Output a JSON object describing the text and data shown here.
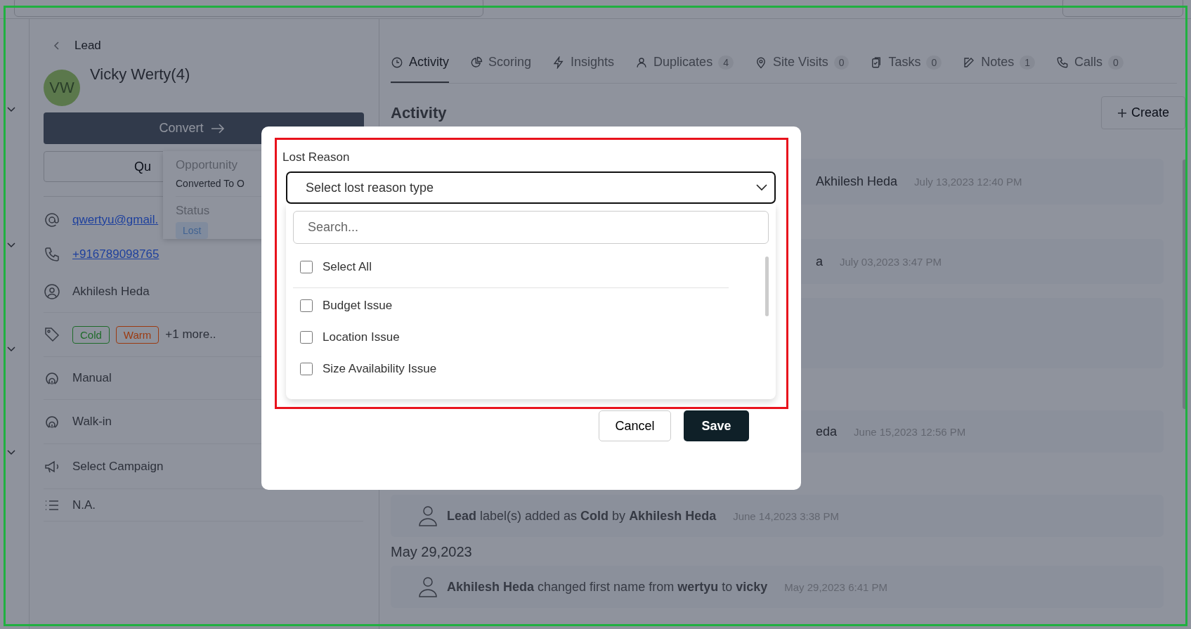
{
  "lead": {
    "back_label": "Lead",
    "initials": "VW",
    "name": "Vicky  Werty(4)",
    "convert_button": "Convert",
    "second_button": "Qu",
    "fields": [
      {
        "kind": "link",
        "text": "qwertyu@gmail."
      },
      {
        "kind": "link",
        "text": "+916789098765"
      },
      {
        "kind": "text",
        "text": "Akhilesh Heda"
      },
      {
        "kind": "tags",
        "tags": [
          {
            "label": "Cold",
            "color": "#1f6b2a"
          },
          {
            "label": "Warm",
            "color": "#9c3a10"
          }
        ],
        "more": "+1 more.."
      },
      {
        "kind": "text",
        "text": "Manual"
      },
      {
        "kind": "text",
        "text": "Walk-in"
      },
      {
        "kind": "text",
        "text": "Select Campaign"
      },
      {
        "kind": "text",
        "text": "N.A."
      }
    ]
  },
  "popover": {
    "title": "Opportunity",
    "value": "Converted To O",
    "status_label": "Status",
    "status": "Lost"
  },
  "tabs": [
    {
      "label": "Activity",
      "selected": true
    },
    {
      "label": "Scoring",
      "selected": false
    },
    {
      "label": "Insights",
      "selected": false
    },
    {
      "label": "Duplicates",
      "count": "4",
      "selected": false
    },
    {
      "label": "Site Visits",
      "count": "0",
      "selected": false
    },
    {
      "label": "Tasks",
      "count": "0",
      "selected": false
    },
    {
      "label": "Notes",
      "count": "1",
      "selected": false
    },
    {
      "label": "Calls",
      "count": "0",
      "selected": false
    }
  ],
  "activity": {
    "heading": "Activity",
    "create_button": "Create",
    "entries": [
      {
        "kind": "partial",
        "text": "Akhilesh Heda",
        "time": "July 13,2023 12:40 PM"
      },
      {
        "kind": "partial",
        "text": "a",
        "time": "July 03,2023 3:47 PM"
      },
      {
        "kind": "blank"
      },
      {
        "kind": "partial",
        "text": "eda",
        "time": "June 15,2023 12:56 PM"
      },
      {
        "kind": "item",
        "text": "**Lead** label(s) added as **Cold** by **Akhilesh Heda**",
        "time": "June 14,2023 3:38 PM"
      },
      {
        "kind": "date",
        "text": "May 29,2023"
      },
      {
        "kind": "item",
        "text": "**Akhilesh Heda** changed first name from **wertyu** to **vicky**",
        "time": "May 29,2023 6:41 PM"
      }
    ]
  },
  "modal": {
    "label": "Lost Reason",
    "select_placeholder": "Select lost reason type",
    "search_placeholder": "Search...",
    "select_all": {
      "label": "Select All",
      "checked": false
    },
    "options": [
      {
        "label": "Budget Issue",
        "checked": false
      },
      {
        "label": "Location Issue",
        "checked": false
      },
      {
        "label": "Size Availability Issue",
        "checked": false
      }
    ],
    "cancel_button": "Cancel",
    "save_button": "Save"
  }
}
